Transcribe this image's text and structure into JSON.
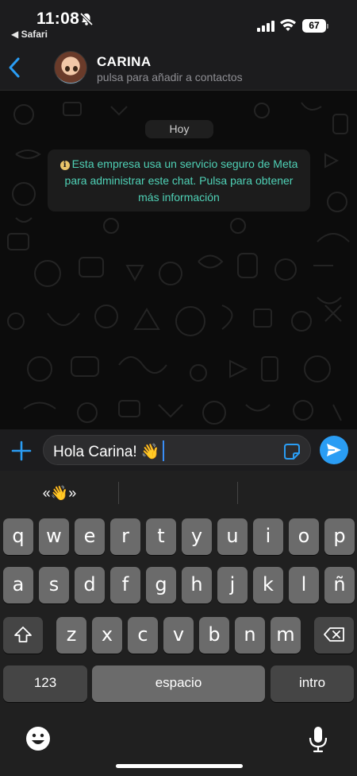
{
  "status_bar": {
    "time": "11:08",
    "back_app": "◀ Safari",
    "battery": "67"
  },
  "header": {
    "contact_name": "CARINA",
    "subtitle": "pulsa para añadir a contactos"
  },
  "chat": {
    "date_chip": "Hoy",
    "info_message": "Esta empresa usa un servicio seguro de Meta para administrar este chat. Pulsa para obtener más información",
    "info_icon": "i"
  },
  "composer": {
    "value": "Hola Carina! 👋"
  },
  "keyboard": {
    "suggestions": [
      "«👋»",
      "",
      ""
    ],
    "row1": [
      "q",
      "w",
      "e",
      "r",
      "t",
      "y",
      "u",
      "i",
      "o",
      "p"
    ],
    "row2": [
      "a",
      "s",
      "d",
      "f",
      "g",
      "h",
      "j",
      "k",
      "l",
      "ñ"
    ],
    "row3": [
      "z",
      "x",
      "c",
      "v",
      "b",
      "n",
      "m"
    ],
    "numbers_key": "123",
    "space_key": "espacio",
    "return_key": "intro"
  },
  "colors": {
    "accent": "#2a9df4",
    "info_text": "#4fd1b6",
    "info_icon": "#e9c46a"
  }
}
